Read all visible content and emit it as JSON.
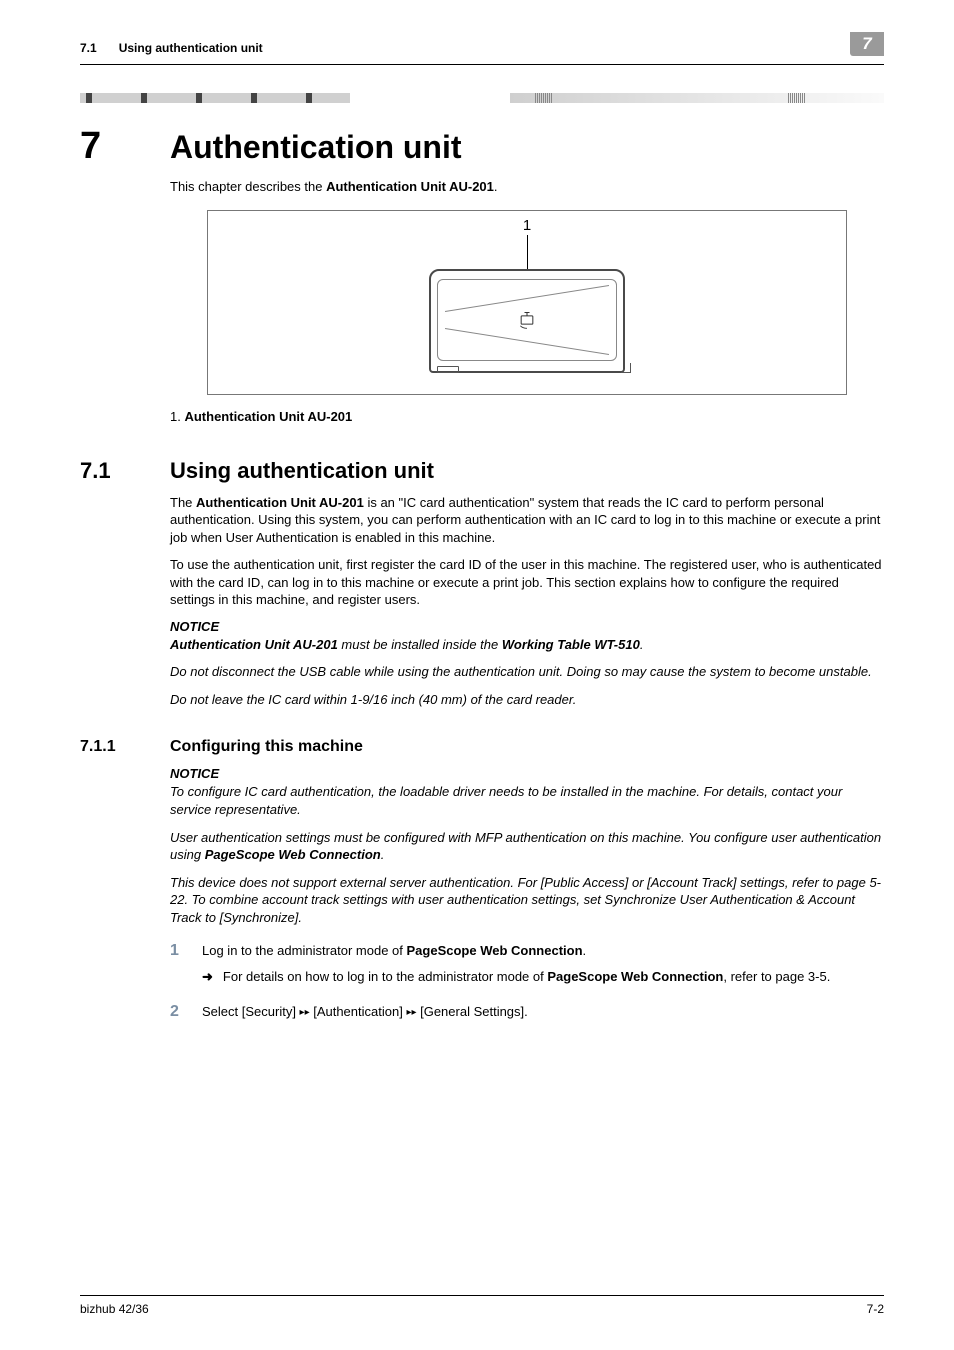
{
  "header": {
    "section_no": "7.1",
    "section_title": "Using authentication unit",
    "chapter_tab": "7"
  },
  "chapter": {
    "number": "7",
    "title": "Authentication unit",
    "intro_pre": "This chapter describes the ",
    "intro_bold": "Authentication Unit AU-201",
    "intro_post": "."
  },
  "figure": {
    "callout": "1",
    "caption_pre": "1. ",
    "caption_bold": "Authentication Unit AU-201"
  },
  "section71": {
    "number": "7.1",
    "title": "Using authentication unit",
    "p1_pre": "The ",
    "p1_bold": "Authentication Unit AU-201",
    "p1_post": " is an \"IC card authentication\" system that reads the IC card to perform personal authentication. Using this system, you can perform authentication with an IC card to log in to this machine or execute a print job when User Authentication is enabled in this machine.",
    "p2": "To use the authentication unit, first register the card ID of the user in this machine. The registered user, who is authenticated with the card ID, can log in to this machine or execute a print job. This section explains how to configure the required settings in this machine, and register users.",
    "notice_label": "NOTICE",
    "n1_b1": "Authentication Unit AU-201",
    "n1_mid": " must be installed inside the ",
    "n1_b2": "Working Table WT-510",
    "n1_end": ".",
    "n2": "Do not disconnect the USB cable while using the authentication unit. Doing so may cause the system to become unstable.",
    "n3": "Do not leave the IC card within 1-9/16 inch (40 mm) of the card reader."
  },
  "section711": {
    "number": "7.1.1",
    "title": "Configuring this machine",
    "notice_label": "NOTICE",
    "n1": "To configure IC card authentication, the loadable driver needs to be installed in the machine. For details, contact your service representative.",
    "n2_pre": "User authentication settings must be configured with MFP authentication on this machine. You configure user authentication using ",
    "n2_bold": "PageScope Web Connection",
    "n2_post": ".",
    "n3": "This device does not support external server authentication. For [Public Access] or [Account Track] settings, refer to page 5-22. To combine account track settings with user authentication settings, set Synchronize User Authentication & Account Track to [Synchronize].",
    "steps": {
      "s1_num": "1",
      "s1_pre": "Log in to the administrator mode of ",
      "s1_bold": "PageScope Web Connection",
      "s1_post": ".",
      "s1_sub_arrow": "➜",
      "s1_sub_pre": "For details on how to log in to the administrator mode of ",
      "s1_sub_bold": "PageScope Web Connection",
      "s1_sub_post": ", refer to page 3-5.",
      "s2_num": "2",
      "s2_text_a": "Select [Security] ",
      "s2_text_b": " [Authentication] ",
      "s2_text_c": " [General Settings].",
      "tri": "▸▸"
    }
  },
  "footer": {
    "left": "bizhub 42/36",
    "right": "7-2"
  }
}
